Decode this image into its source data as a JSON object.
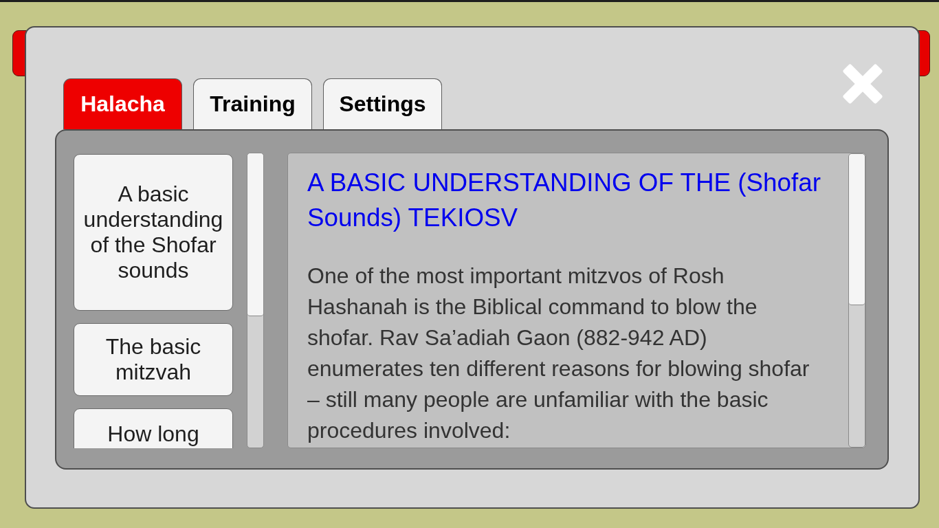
{
  "tabs": [
    {
      "label": "Halacha",
      "selected": true
    },
    {
      "label": "Training",
      "selected": false
    },
    {
      "label": "Settings",
      "selected": false
    }
  ],
  "topics": [
    {
      "label": "A basic understanding of the Shofar sounds"
    },
    {
      "label": "The basic mitzvah"
    },
    {
      "label": "How long"
    }
  ],
  "article": {
    "title": "A BASIC UNDERSTANDING OF THE (Shofar Sounds) TEKIOSV",
    "body": "One of the most important mitzvos of Rosh Hashanah is the Biblical command to blow the shofar. Rav Sa’adiah Gaon (882-942 AD) enumerates ten different reasons for blowing shofar – still many people are unfamiliar with the basic procedures involved:"
  }
}
